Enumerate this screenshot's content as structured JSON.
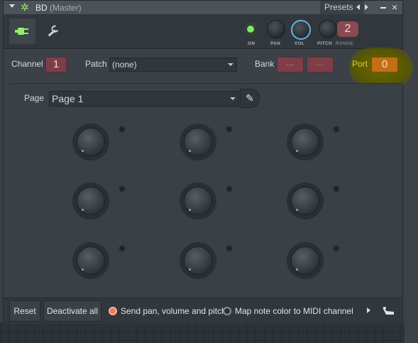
{
  "window": {
    "title": "BD",
    "title_sub": "(Master)",
    "presets_label": "Presets",
    "close_glyph": "×"
  },
  "toolbar": {
    "on_label": "ON",
    "pan_label": "PAN",
    "vol_label": "VOL",
    "pitch_label": "PITCH",
    "range_label": "RANGE",
    "range_value": "2"
  },
  "channel_row": {
    "channel_label": "Channel",
    "channel_value": "1",
    "patch_label": "Patch",
    "patch_value": "(none)",
    "bank_label": "Bank",
    "bank_value_1": "---",
    "bank_value_2": "---",
    "port_label": "Port",
    "port_value": "0"
  },
  "page": {
    "label": "Page",
    "value": "Page 1"
  },
  "bottom": {
    "reset_label": "Reset",
    "deactivate_label": "Deactivate all",
    "send_label": "Send pan, volume and pitch",
    "send_checked": true,
    "map_label": "Map note color to MIDI channel",
    "map_checked": false
  },
  "colors": {
    "accent_green": "#7fe86a",
    "channel_box": "#7f3e47",
    "port_box": "#c46f16",
    "highlight": "#6e6a00",
    "vol_ring": "#5bb7e6"
  },
  "icons": [
    "gear-icon",
    "plug-icon",
    "wrench-icon",
    "pencil-icon",
    "speaker-icon"
  ]
}
